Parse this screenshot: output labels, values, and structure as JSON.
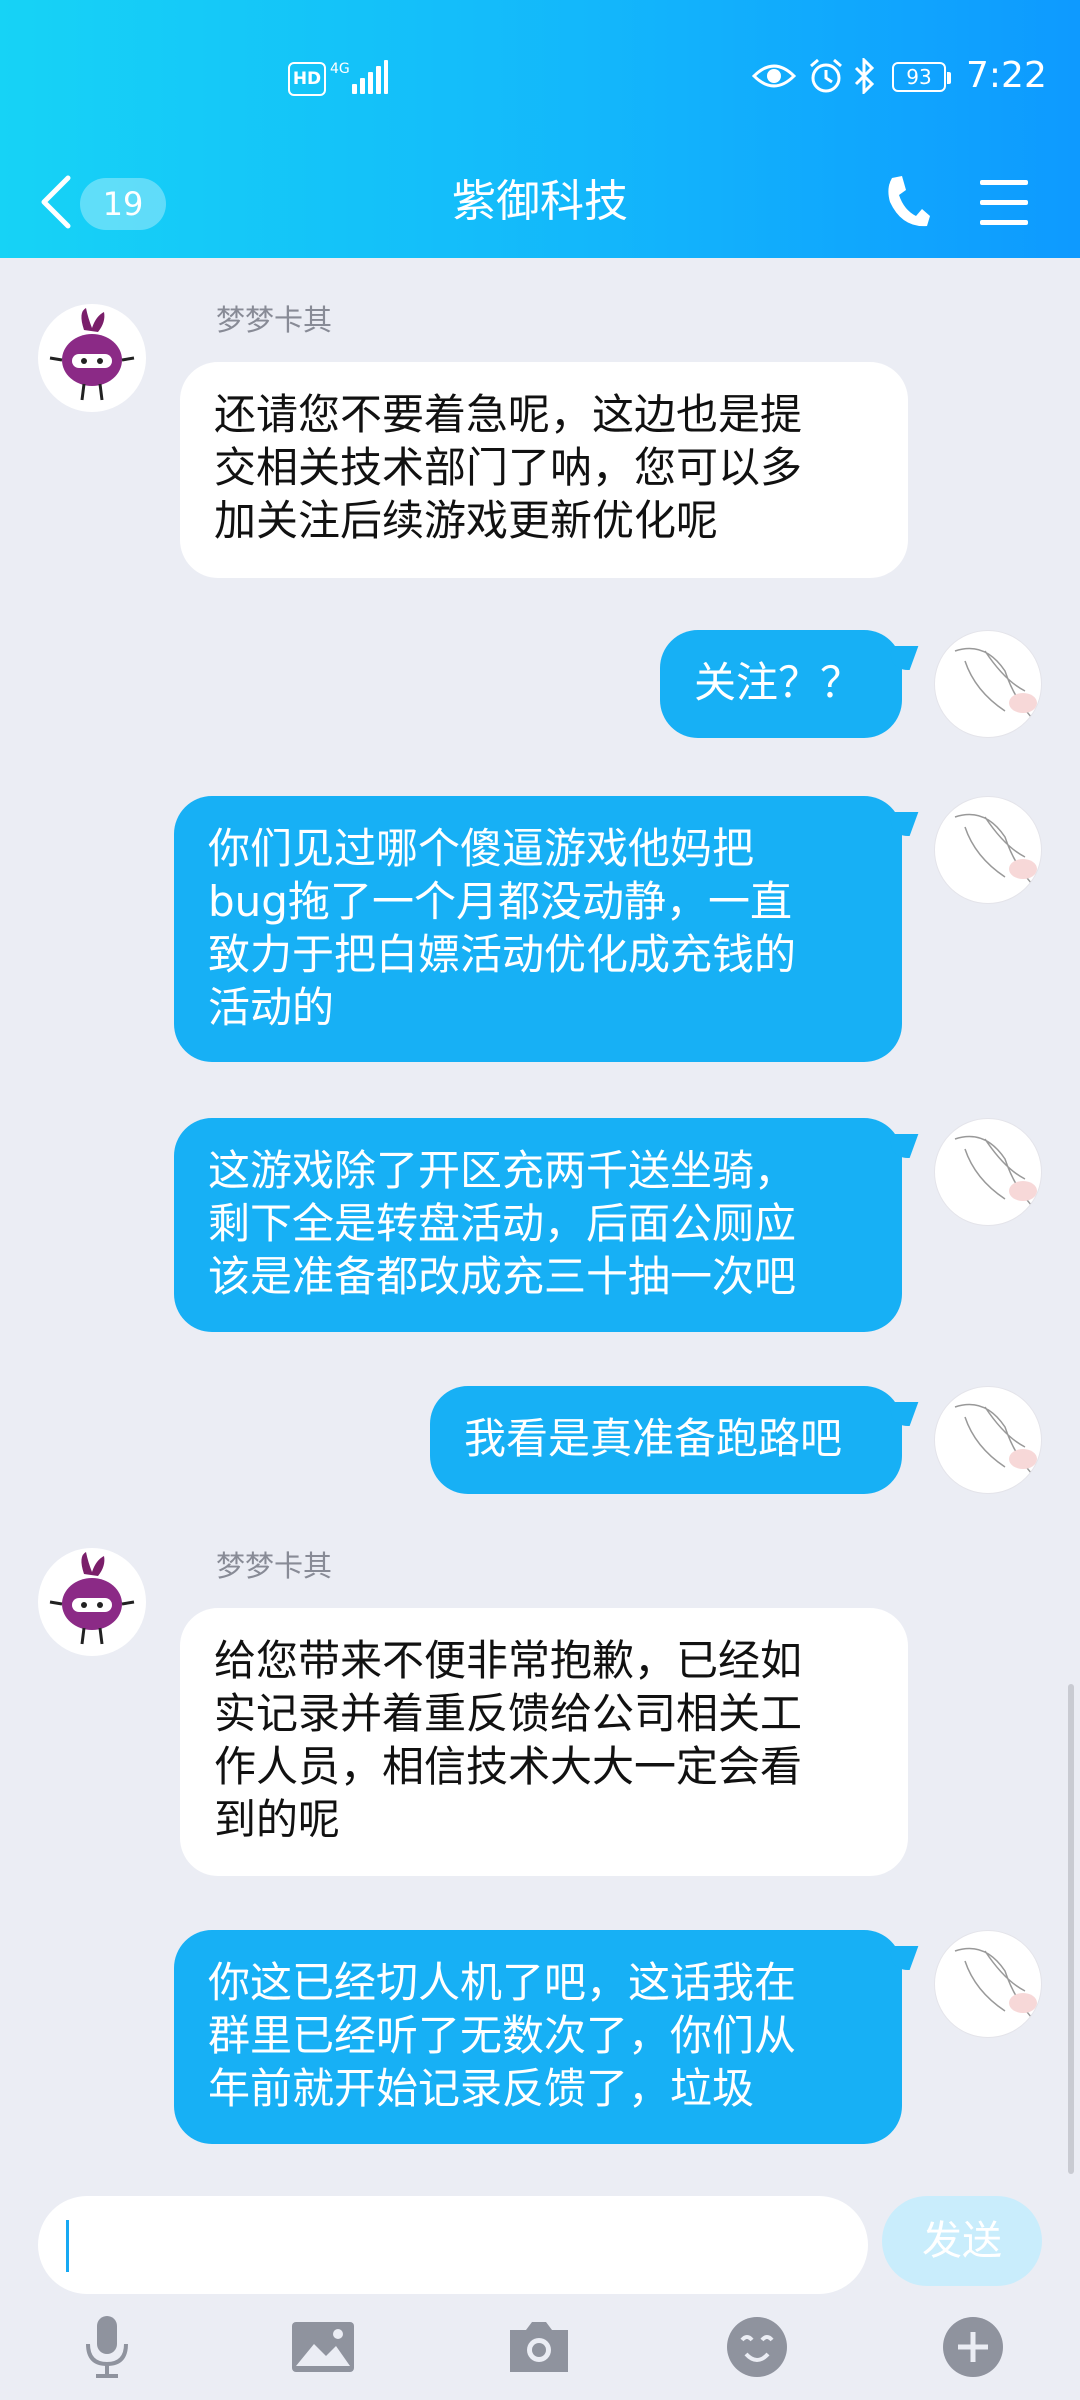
{
  "status_bar": {
    "hd": "HD",
    "network": "4G",
    "battery": "93",
    "time": "7:22"
  },
  "nav": {
    "unread_count": "19",
    "title": "紫御科技"
  },
  "messages": [
    {
      "side": "in",
      "sender": "梦梦卡其",
      "text": "还请您不要着急呢，这边也是提\n交相关技术部门了呐，您可以多\n加关注后续游戏更新优化呢"
    },
    {
      "side": "out",
      "text": "关注？？"
    },
    {
      "side": "out",
      "text": "你们见过哪个傻逼游戏他妈把\nbug拖了一个月都没动静，一直\n致力于把白嫖活动优化成充钱的\n活动的"
    },
    {
      "side": "out",
      "text": "这游戏除了开区充两千送坐骑，\n剩下全是转盘活动，后面公厕应\n该是准备都改成充三十抽一次吧"
    },
    {
      "side": "out",
      "text": "我看是真准备跑路吧"
    },
    {
      "side": "in",
      "sender": "梦梦卡其",
      "text": "给您带来不便非常抱歉，已经如\n实记录并着重反馈给公司相关工\n作人员，相信技术大大一定会看\n到的呢"
    },
    {
      "side": "out",
      "text": "你这已经切人机了吧，这话我在\n群里已经听了无数次了，你们从\n年前就开始记录反馈了，垃圾"
    }
  ],
  "composer": {
    "value": "",
    "send_label": "发送"
  },
  "colors": {
    "header_start": "#16D3F6",
    "header_end": "#0E9AFF",
    "outgoing_bubble": "#17B0F5",
    "background": "#EBEDF4"
  },
  "toolbar_icons": [
    "microphone-icon",
    "image-icon",
    "camera-icon",
    "emoji-icon",
    "plus-icon"
  ]
}
